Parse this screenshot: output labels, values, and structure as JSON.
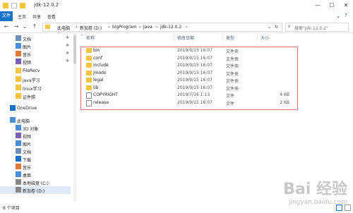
{
  "window": {
    "title": "jdk-12.0.2",
    "btn_min": "—",
    "btn_max": "☐",
    "btn_close": "✕"
  },
  "ribbon": {
    "tabs": [
      "文件",
      "主页",
      "共享",
      "查看"
    ]
  },
  "nav": {
    "back": "←",
    "forward": "→",
    "dropdown": "⌄",
    "up": "↑",
    "crumbs": [
      "此电脑",
      "新加卷 (D:)",
      "bigProgram",
      "Java",
      "jdk-12.0.2"
    ],
    "refresh": "↻",
    "search_placeholder": "搜索\"jdk-12.0.2\""
  },
  "sidebar": {
    "items": [
      {
        "label": "文档",
        "icon": "document-icon",
        "pin": true,
        "sel": false
      },
      {
        "label": "图片",
        "icon": "picture-icon",
        "pin": true,
        "sel": false
      },
      {
        "label": "音乐",
        "icon": "music-icon",
        "pin": true,
        "sel": false
      },
      {
        "label": "视频",
        "icon": "video-icon",
        "pin": true,
        "sel": false
      },
      {
        "label": "FileRecv",
        "icon": "folder-icon",
        "pin": false,
        "sel": false
      },
      {
        "label": "java学习",
        "icon": "folder-icon",
        "pin": false,
        "sel": false
      },
      {
        "label": "linux学习",
        "icon": "folder-icon",
        "pin": false,
        "sel": false
      },
      {
        "label": "证件照",
        "icon": "folder-icon",
        "pin": false,
        "sel": false
      },
      {
        "label": "OneDrive",
        "icon": "onedrive-icon",
        "pin": false,
        "sel": false
      },
      {
        "label": "此电脑",
        "icon": "computer-icon",
        "pin": false,
        "sel": false
      },
      {
        "label": "3D 对象",
        "icon": "cube-icon",
        "pin": false,
        "sel": false
      },
      {
        "label": "视频",
        "icon": "video-icon",
        "pin": false,
        "sel": false
      },
      {
        "label": "图片",
        "icon": "picture-icon",
        "pin": false,
        "sel": false
      },
      {
        "label": "文档",
        "icon": "document-icon",
        "pin": false,
        "sel": false
      },
      {
        "label": "下载",
        "icon": "download-icon",
        "pin": false,
        "sel": false
      },
      {
        "label": "音乐",
        "icon": "music-icon",
        "pin": false,
        "sel": false
      },
      {
        "label": "桌面",
        "icon": "desktop-icon",
        "pin": false,
        "sel": false
      },
      {
        "label": "本地磁盘 (C:)",
        "icon": "drive-icon",
        "pin": false,
        "sel": false
      },
      {
        "label": "新加卷 (D:)",
        "icon": "drive-icon",
        "pin": false,
        "sel": true
      }
    ]
  },
  "columns": {
    "name": "名称",
    "date": "修改日期",
    "type": "类型",
    "size": "大小"
  },
  "files": [
    {
      "name": "bin",
      "date": "2019/9/15 16:07",
      "type": "文件夹",
      "size": "",
      "kind": "folder"
    },
    {
      "name": "conf",
      "date": "2019/9/15 16:07",
      "type": "文件夹",
      "size": "",
      "kind": "folder"
    },
    {
      "name": "include",
      "date": "2019/9/15 16:07",
      "type": "文件夹",
      "size": "",
      "kind": "folder"
    },
    {
      "name": "jmods",
      "date": "2019/9/15 16:07",
      "type": "文件夹",
      "size": "",
      "kind": "folder"
    },
    {
      "name": "legal",
      "date": "2019/9/15 16:07",
      "type": "文件夹",
      "size": "",
      "kind": "folder"
    },
    {
      "name": "lib",
      "date": "2019/9/15 16:07",
      "type": "文件夹",
      "size": "",
      "kind": "folder"
    },
    {
      "name": "COPYRIGHT",
      "date": "2019/7/16 1:13",
      "type": "文件",
      "size": "4 KB",
      "kind": "file"
    },
    {
      "name": "release",
      "date": "2019/9/15 16:07",
      "type": "文件",
      "size": "2 KB",
      "kind": "file"
    }
  ],
  "status": {
    "count": "8 个项目"
  },
  "watermark": {
    "main": "Bai 经验",
    "sub": "jingyan.baidu.com"
  },
  "colors": {
    "accent": "#1a73c8",
    "folder": "#f5c542",
    "highlight": "#e57373",
    "selected": "#dfe9f5"
  }
}
